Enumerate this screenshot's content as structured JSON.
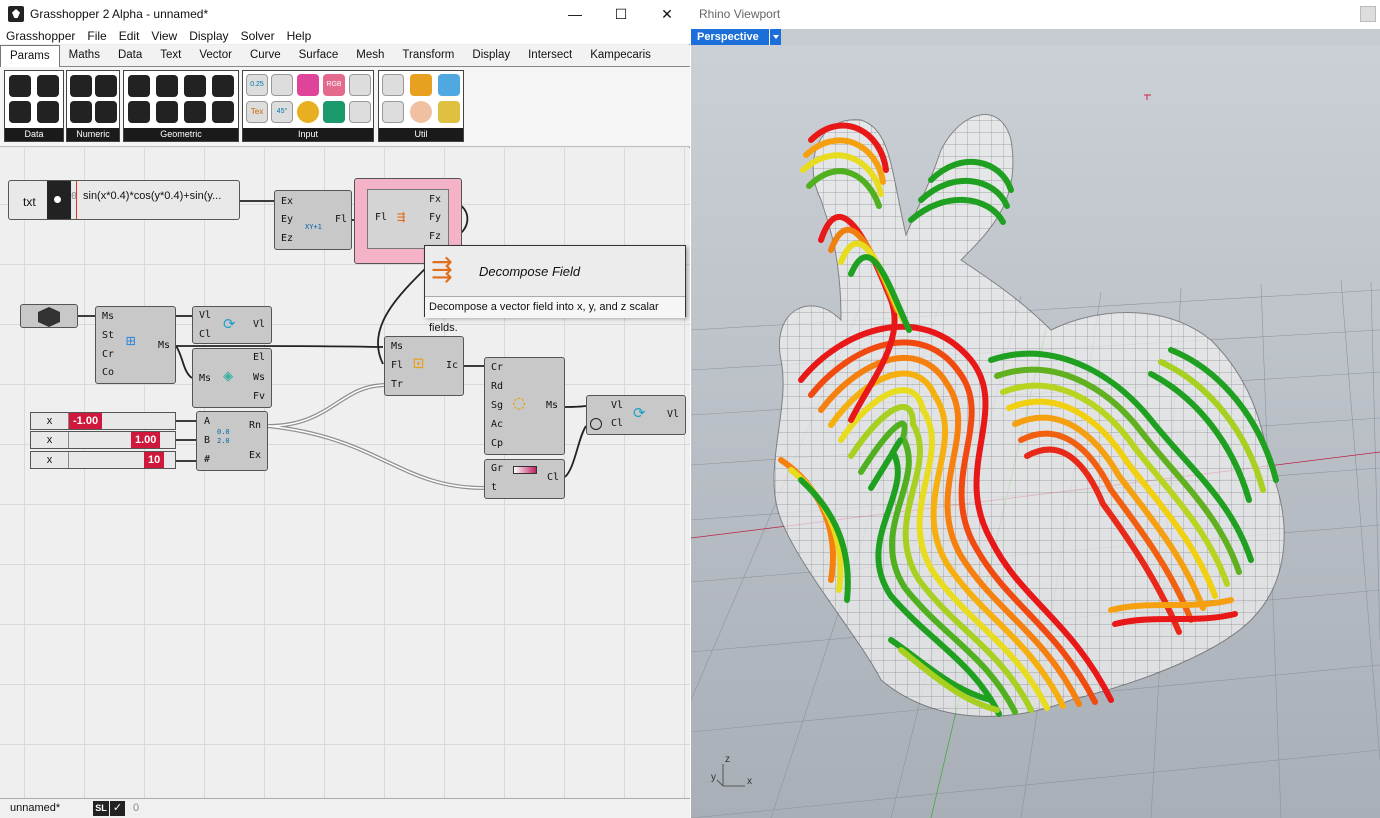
{
  "window": {
    "title": "Grasshopper 2 Alpha - unnamed*",
    "minimize": "—",
    "maximize": "☐",
    "close": "✕"
  },
  "menu": [
    "Grasshopper",
    "File",
    "Edit",
    "View",
    "Display",
    "Solver",
    "Help"
  ],
  "tabs": [
    "Params",
    "Maths",
    "Data",
    "Text",
    "Vector",
    "Curve",
    "Surface",
    "Mesh",
    "Transform",
    "Display",
    "Intersect",
    "Kampecaris"
  ],
  "active_tab": "Params",
  "ribbon_groups": [
    "Data",
    "Numeric",
    "Geometric",
    "Input",
    "Util"
  ],
  "ribbon_icon_labels": {
    "num": "0.25",
    "rgb": "RGB",
    "tex": "Tex",
    "angle": "45°"
  },
  "components": {
    "text_panel": {
      "name": "txt",
      "index": "0",
      "expression": "sin(x*0.4)*cos(y*0.4)+sin(y..."
    },
    "expression_field": {
      "inputs": [
        "Ex",
        "Ey",
        "Ez"
      ],
      "output": "Fl",
      "icon_text": "XY+1"
    },
    "decompose_field": {
      "input": "Fl",
      "outputs": [
        "Fx",
        "Fy",
        "Fz"
      ]
    },
    "mesh_param": {
      "name": "mesh"
    },
    "mesh_comp": {
      "inputs": [
        "Ms",
        "St",
        "Cr",
        "Co"
      ],
      "output": "Ms"
    },
    "value_out_top": {
      "inputs": [
        "Vl",
        "Cl"
      ],
      "output": "Vl"
    },
    "mesh_edges": {
      "input": "Ms",
      "outputs": [
        "El",
        "Ws",
        "Fv"
      ]
    },
    "isocurve": {
      "inputs": [
        "Ms",
        "Fl",
        "Tr"
      ],
      "output": "Ic"
    },
    "sweep": {
      "inputs": [
        "Cr",
        "Rd",
        "Sg",
        "Ac",
        "Cp"
      ],
      "output": "Ms"
    },
    "gradient": {
      "inputs": [
        "Gr",
        "t"
      ],
      "output": "Cl"
    },
    "value_out_bottom": {
      "inputs": [
        "Vl",
        "Cl"
      ],
      "output": "Vl"
    },
    "range": {
      "inputs": [
        "A",
        "B",
        "#"
      ],
      "outputs": [
        "Rn",
        "Ex"
      ],
      "icon_text": "0.0 2.0"
    }
  },
  "sliders": [
    {
      "name": "x",
      "value": "-1.00"
    },
    {
      "name": "x",
      "value": "1.00"
    },
    {
      "name": "x",
      "value": "10"
    }
  ],
  "tooltip": {
    "title": "Decompose Field",
    "description": "Decompose a vector field into x, y, and z scalar fields."
  },
  "status": {
    "file": "unnamed*",
    "count": "0",
    "sl": "SL"
  },
  "viewport": {
    "title": "Rhino Viewport",
    "view": "Perspective",
    "axis_z": "z",
    "axis_y": "y",
    "axis_x": "x"
  },
  "colors": {
    "accent": "#1c6fd8",
    "slider_red": "#d0183c",
    "selected": "#f5b3c8"
  }
}
